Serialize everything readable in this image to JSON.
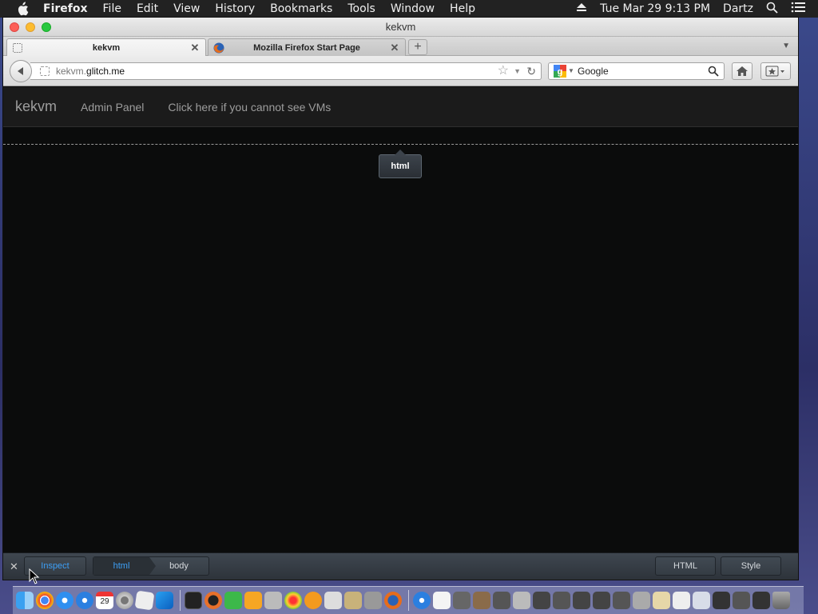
{
  "menubar": {
    "app_name": "Firefox",
    "items": [
      "File",
      "Edit",
      "View",
      "History",
      "Bookmarks",
      "Tools",
      "Window",
      "Help"
    ],
    "clock": "Tue Mar 29  9:13 PM",
    "user": "Dartz"
  },
  "window": {
    "title": "kekvm",
    "tabs": [
      {
        "label": "kekvm",
        "active": true
      },
      {
        "label": "Mozilla Firefox Start Page",
        "active": false
      }
    ]
  },
  "navbar": {
    "url_subdomain": "kekvm.",
    "url_host": "glitch.me",
    "search_engine": "Google"
  },
  "site": {
    "brand": "kekvm",
    "links": [
      "Admin Panel",
      "Click here if you cannot see VMs"
    ]
  },
  "inspector": {
    "node_tooltip": "html",
    "inspect_label": "Inspect",
    "breadcrumbs": [
      "html",
      "body"
    ],
    "html_button": "HTML",
    "style_button": "Style",
    "close_icon": "close-icon"
  },
  "dock": {
    "apps": [
      "finder",
      "chrome",
      "safari",
      "app-store",
      "calendar",
      "system-preferences",
      "photos",
      "windows",
      "terminal",
      "activity-monitor",
      "facetime",
      "home",
      "automator",
      "photo-booth",
      "ibooks",
      "instruments",
      "archive",
      "disk-utility",
      "firefox",
      "launchpad",
      "preview",
      "documents",
      "downloads",
      "trash"
    ],
    "calendar_day": "29"
  },
  "colors": {
    "accent_blue": "#3d9ff5",
    "nav_text": "#9d9d9d",
    "page_bg": "#0b0c0c"
  }
}
